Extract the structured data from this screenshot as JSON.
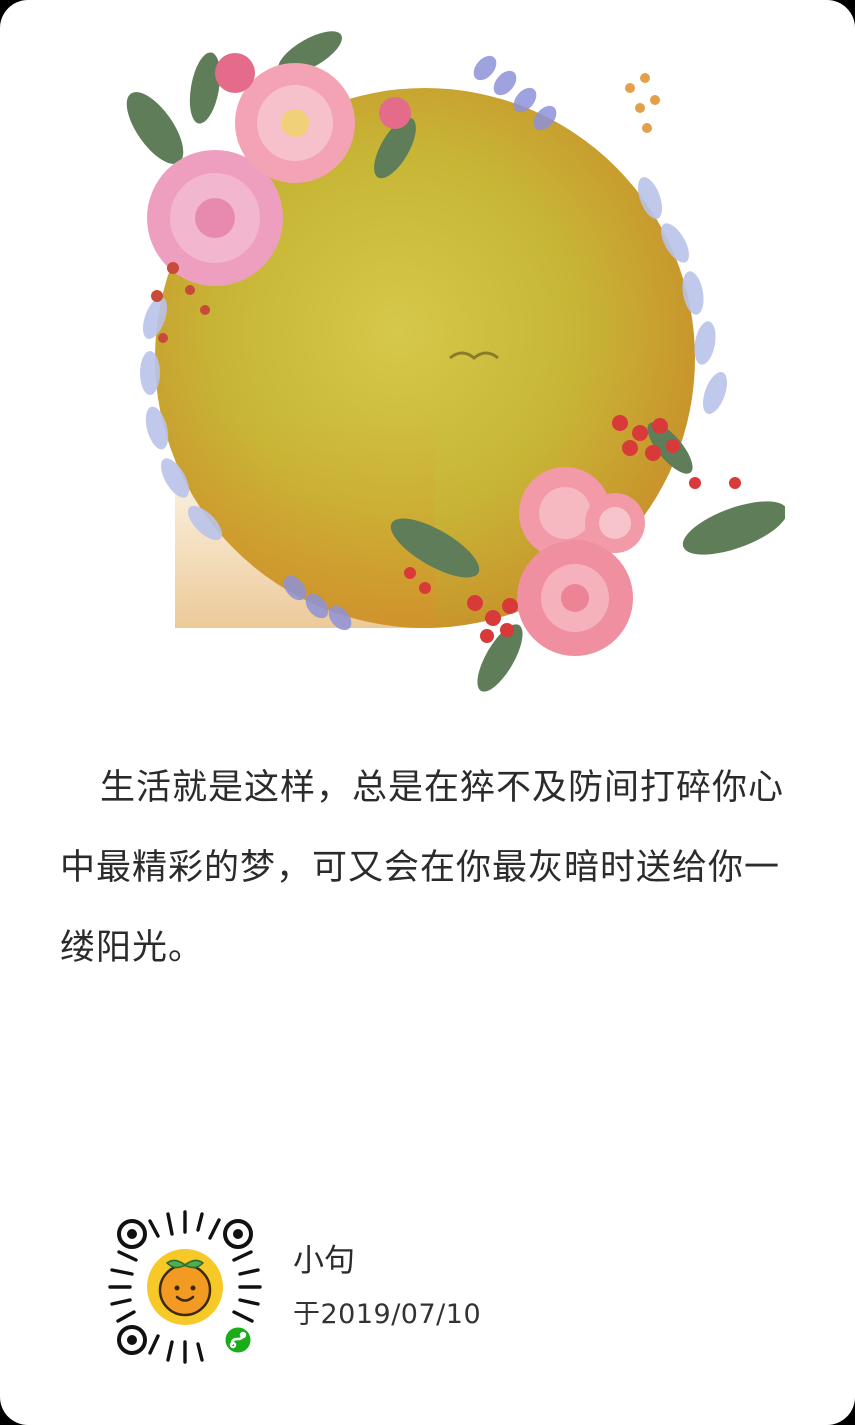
{
  "post": {
    "quote": "生活就是这样，总是在猝不及防间打碎你心中最精彩的梦，可又会在你最灰暗时送给你一缕阳光。",
    "author": "小句",
    "date": "于2019/07/10"
  },
  "colors": {
    "background": "#ffffff",
    "moon": "#c9bb3a",
    "rose": "#f29aa8",
    "peony": "#e88ab0",
    "leaf": "#5f7d58",
    "lavender": "#6b6fc7",
    "berry": "#d83a3a",
    "qr_center": "#f7c928",
    "orange": "#f39a22",
    "miniprogram_badge": "#1aad19"
  },
  "icons": {
    "artwork": "floral-wreath-moon",
    "qr": "miniprogram-qr-code",
    "badge": "miniprogram-icon"
  }
}
